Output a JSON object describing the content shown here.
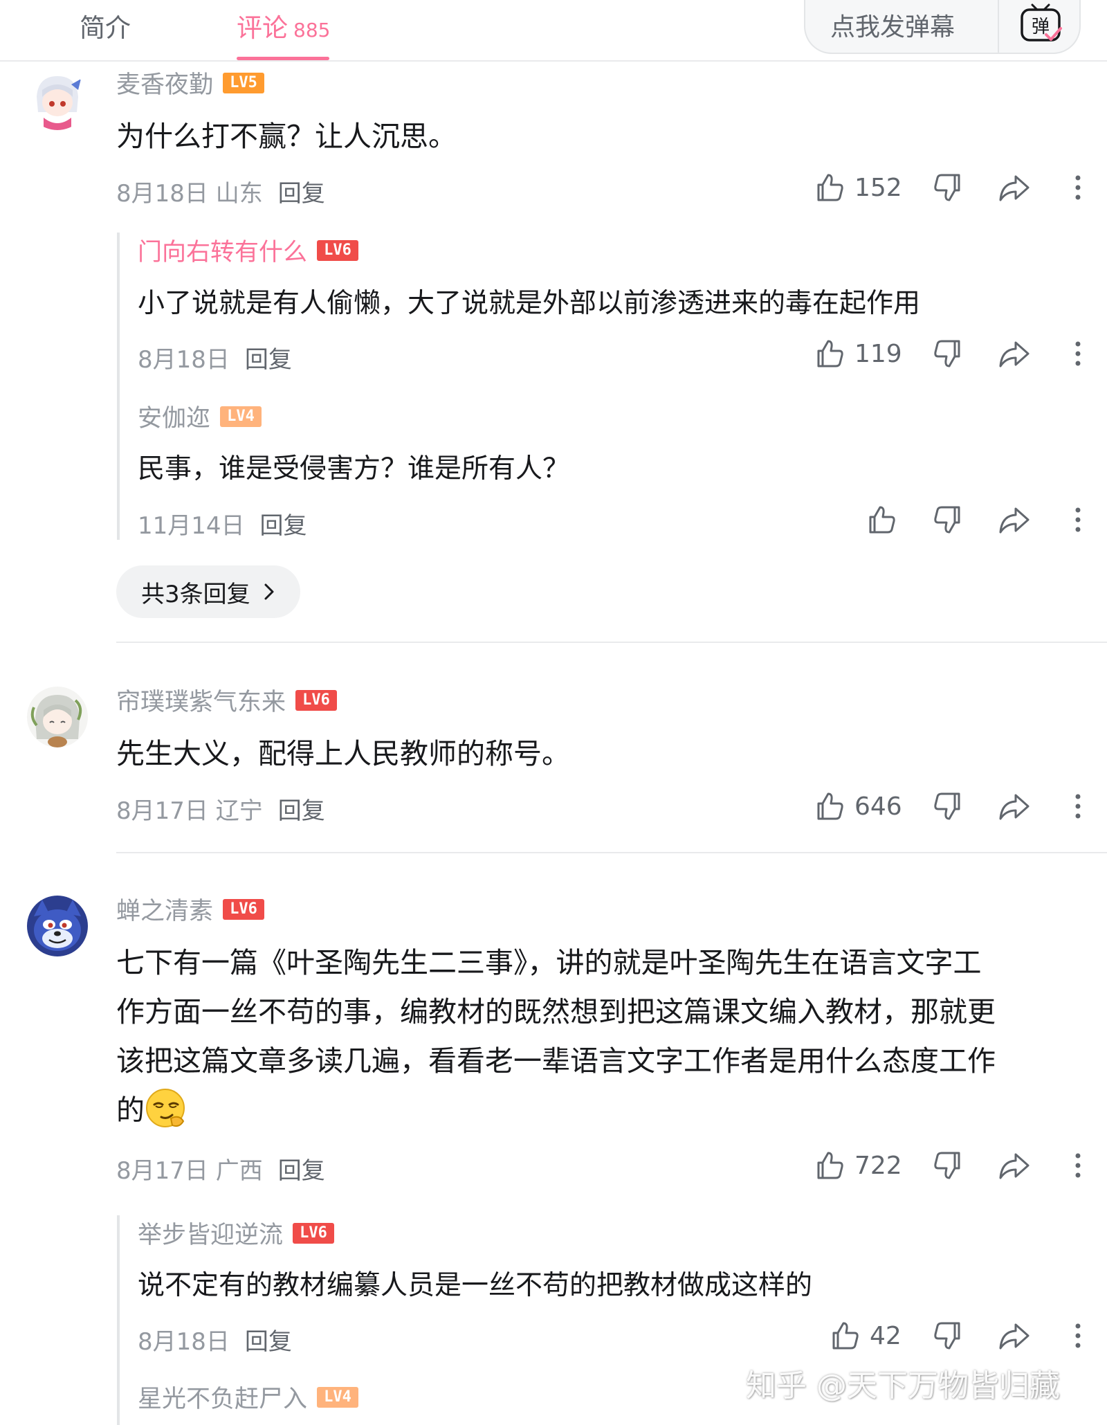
{
  "tabs": {
    "intro": "简介",
    "comments": "评论",
    "comments_count": "885"
  },
  "danmaku": {
    "placeholder": "点我发弹幕",
    "toggle_glyph": "弹"
  },
  "comments": [
    {
      "user": "麦香夜勤",
      "level": "LV5",
      "text": "为什么打不赢？让人沉思。",
      "date": "8月18日",
      "location": "山东",
      "reply_label": "回复",
      "likes": "152",
      "replies": [
        {
          "user": "门向右转有什么",
          "level": "LV6",
          "text": "小了说就是有人偷懒，大了说就是外部以前渗透进来的毒在起作用",
          "date": "8月18日",
          "reply_label": "回复",
          "likes": "119"
        },
        {
          "user": "安伽迩",
          "level": "LV4",
          "text": "民事，谁是受侵害方？谁是所有人？",
          "date": "11月14日",
          "reply_label": "回复",
          "likes": ""
        }
      ],
      "more_replies": "共3条回复"
    },
    {
      "user": "帘璞璞紫气东来",
      "level": "LV6",
      "text": "先生大义，配得上人民教师的称号。",
      "date": "8月17日",
      "location": "辽宁",
      "reply_label": "回复",
      "likes": "646"
    },
    {
      "user": "蝉之清素",
      "level": "LV6",
      "text_lines": [
        "七下有一篇《叶圣陶先生二三事》，讲的就是叶圣陶先生在语言文字工",
        "作方面一丝不苟的事，编教材的既然想到把这篇课文编入教材，那就更",
        "该把这篇文章多读几遍，看看老一辈语言文字工作者是用什么态度工作",
        "的"
      ],
      "emoji": "smirk-emoji",
      "date": "8月17日",
      "location": "广西",
      "reply_label": "回复",
      "likes": "722",
      "replies": [
        {
          "user": "举步皆迎逆流",
          "level": "LV6",
          "text": "说不定有的教材编纂人员是一丝不苟的把教材做成这样的",
          "date": "8月18日",
          "reply_label": "回复",
          "likes": "42"
        },
        {
          "user": "星光不负赶尸入",
          "level": "LV4"
        }
      ]
    }
  ],
  "watermark": "知乎 @天下万物皆归藏",
  "colors": {
    "accent": "#fb7299",
    "lv4": "#ffb37c",
    "lv5": "#ff9b2f",
    "lv6": "#f04c49",
    "muted": "#9499a0"
  }
}
